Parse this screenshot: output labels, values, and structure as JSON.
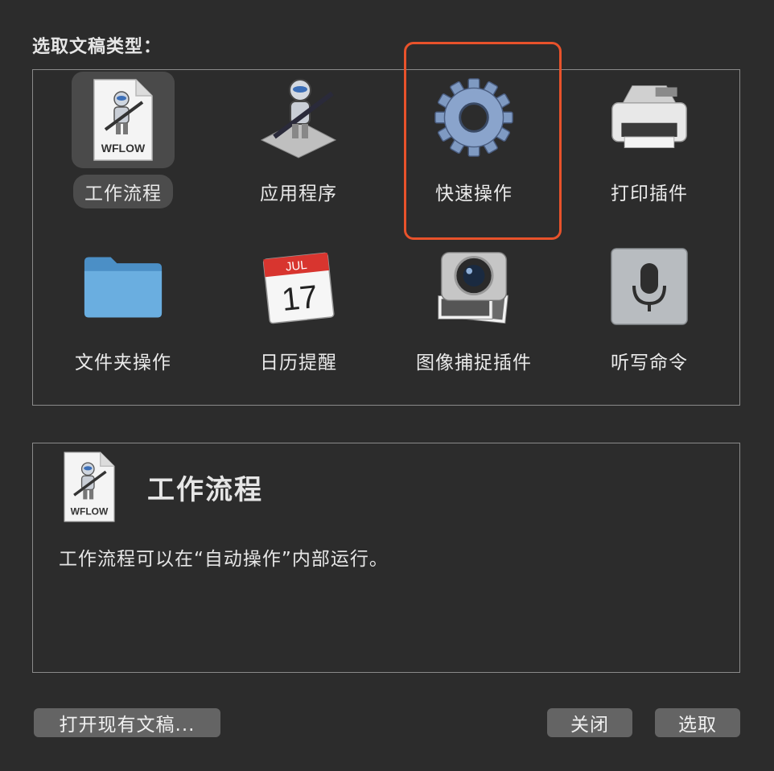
{
  "prompt": "选取文稿类型：",
  "types": [
    {
      "label": "工作流程",
      "icon": "workflow-file-icon",
      "selected": true
    },
    {
      "label": "应用程序",
      "icon": "automator-robot-icon",
      "selected": false
    },
    {
      "label": "快速操作",
      "icon": "gear-icon",
      "selected": false
    },
    {
      "label": "打印插件",
      "icon": "printer-icon",
      "selected": false
    },
    {
      "label": "文件夹操作",
      "icon": "folder-icon",
      "selected": false
    },
    {
      "label": "日历提醒",
      "icon": "calendar-icon",
      "selected": false
    },
    {
      "label": "图像捕捉插件",
      "icon": "camera-icon",
      "selected": false
    },
    {
      "label": "听写命令",
      "icon": "microphone-icon",
      "selected": false
    }
  ],
  "workflow_file_badge": "WFLOW",
  "calendar": {
    "month": "JUL",
    "day": "17"
  },
  "description": {
    "title": "工作流程",
    "text": "工作流程可以在“自动操作”内部运行。",
    "icon_badge": "WFLOW"
  },
  "buttons": {
    "open_existing": "打开现有文稿...",
    "close": "关闭",
    "select": "选取"
  },
  "colors": {
    "highlight": "#e8522b",
    "background": "#2c2c2c",
    "button": "#646464"
  }
}
